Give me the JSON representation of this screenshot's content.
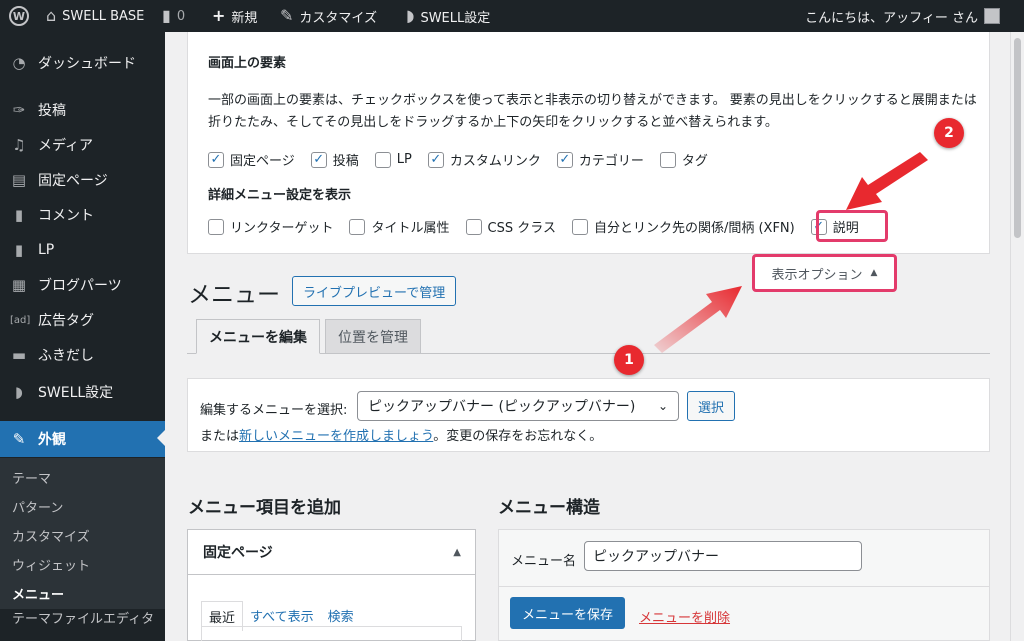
{
  "admin_bar": {
    "site_name": "SWELL BASE",
    "comments_count": "0",
    "new_label": "新規",
    "customize_label": "カスタマイズ",
    "swell_settings_label": "SWELL設定",
    "greeting": "こんにちは、アッフィー さん"
  },
  "sidebar": {
    "items": [
      {
        "label": "ダッシュボード",
        "icon": "dashboard-icon"
      },
      {
        "label": "投稿",
        "icon": "pin-icon"
      },
      {
        "label": "メディア",
        "icon": "media-icon"
      },
      {
        "label": "固定ページ",
        "icon": "page-icon"
      },
      {
        "label": "コメント",
        "icon": "comment-icon"
      },
      {
        "label": "LP",
        "icon": "document-icon"
      },
      {
        "label": "ブログパーツ",
        "icon": "grid-icon"
      },
      {
        "label": "広告タグ",
        "icon": "ad-icon"
      },
      {
        "label": "ふきだし",
        "icon": "bubble-icon"
      },
      {
        "label": "SWELL設定",
        "icon": "swell-icon"
      },
      {
        "label": "外観",
        "icon": "brush-icon"
      }
    ],
    "submenu": [
      "テーマ",
      "パターン",
      "カスタマイズ",
      "ウィジェット",
      "メニュー",
      "テーマファイルエディタ"
    ],
    "active_submenu": "メニュー"
  },
  "screen_options": {
    "title": "画面上の要素",
    "description": "一部の画面上の要素は、チェックボックスを使って表示と非表示の切り替えができます。 要素の見出しをクリックすると展開または折りたたみ、そしてその見出しをドラッグするか上下の矢印をクリックすると並べ替えられます。",
    "boxes": [
      {
        "label": "固定ページ",
        "checked": true
      },
      {
        "label": "投稿",
        "checked": true
      },
      {
        "label": "LP",
        "checked": false
      },
      {
        "label": "カスタムリンク",
        "checked": true
      },
      {
        "label": "カテゴリー",
        "checked": true
      },
      {
        "label": "タグ",
        "checked": false
      }
    ],
    "advanced_title": "詳細メニュー設定を表示",
    "advanced": [
      {
        "label": "リンクターゲット",
        "checked": false
      },
      {
        "label": "タイトル属性",
        "checked": false
      },
      {
        "label": "CSS クラス",
        "checked": false
      },
      {
        "label": "自分とリンク先の関係/間柄 (XFN)",
        "checked": false
      },
      {
        "label": "説明",
        "checked": true
      }
    ],
    "toggle_label": "表示オプション"
  },
  "page": {
    "title": "メニュー",
    "live_preview_label": "ライブプレビューで管理",
    "tabs": [
      "メニューを編集",
      "位置を管理"
    ]
  },
  "select_menu": {
    "label": "編集するメニューを選択:",
    "selected": "ピックアップバナー (ピックアップバナー)",
    "select_button": "選択",
    "note_prefix": "または",
    "note_link": "新しいメニューを作成しましょう",
    "note_suffix": "。変更の保存をお忘れなく。"
  },
  "add_items": {
    "title": "メニュー項目を追加",
    "section_title": "固定ページ",
    "tabs": [
      "最近",
      "すべて表示",
      "検索"
    ]
  },
  "structure": {
    "title": "メニュー構造",
    "name_label": "メニュー名",
    "name_value": "ピックアップバナー",
    "save_label": "メニューを保存",
    "delete_label": "メニューを削除"
  },
  "annotations": {
    "badge_1": "1",
    "badge_2": "2",
    "highlight_color": "#e33b6b",
    "arrow_color": "#e8292f"
  }
}
